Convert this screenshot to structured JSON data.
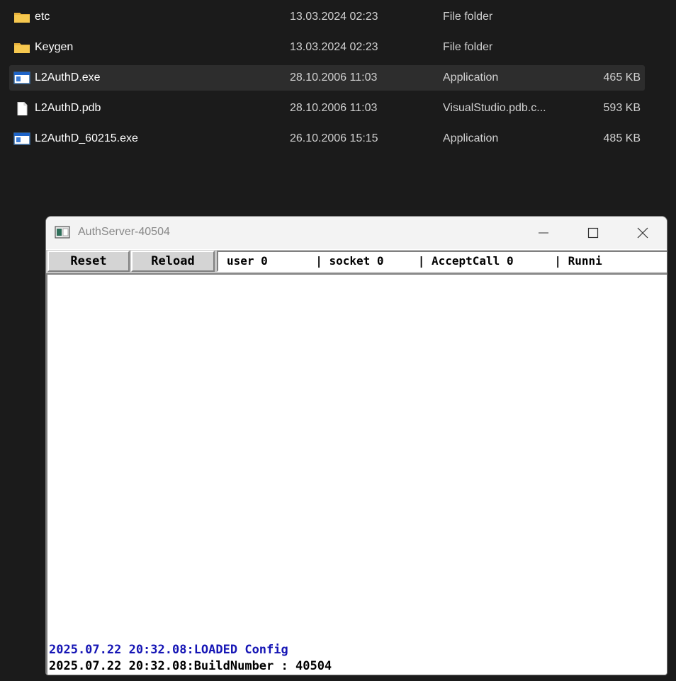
{
  "explorer": {
    "rows": [
      {
        "name": "etc",
        "date": "13.03.2024 02:23",
        "type": "File folder",
        "size": "",
        "icon": "folder-icon"
      },
      {
        "name": "Keygen",
        "date": "13.03.2024 02:23",
        "type": "File folder",
        "size": "",
        "icon": "folder-icon"
      },
      {
        "name": "L2AuthD.exe",
        "date": "28.10.2006 11:03",
        "type": "Application",
        "size": "465 KB",
        "icon": "application-icon",
        "selected": true
      },
      {
        "name": "L2AuthD.pdb",
        "date": "28.10.2006 11:03",
        "type": "VisualStudio.pdb.c...",
        "size": "593 KB",
        "icon": "file-icon"
      },
      {
        "name": "L2AuthD_60215.exe",
        "date": "26.10.2006 15:15",
        "type": "Application",
        "size": "485 KB",
        "icon": "application-icon"
      }
    ]
  },
  "window": {
    "title": "AuthServer-40504",
    "icon": "application-window-icon",
    "controls": {
      "minimize": "minimize-icon",
      "maximize": "maximize-icon",
      "close": "close-icon"
    },
    "toolbar": {
      "reset_label": "Reset",
      "reload_label": "Reload",
      "status_text": "user 0       | socket 0     | AcceptCall 0      | Runni"
    },
    "log": [
      {
        "text": "2025.07.22 20:32.08:LOADED Config",
        "color": "#1515b5"
      },
      {
        "text": "2025.07.22 20:32.08:BuildNumber : 40504",
        "color": "#000000"
      }
    ]
  }
}
